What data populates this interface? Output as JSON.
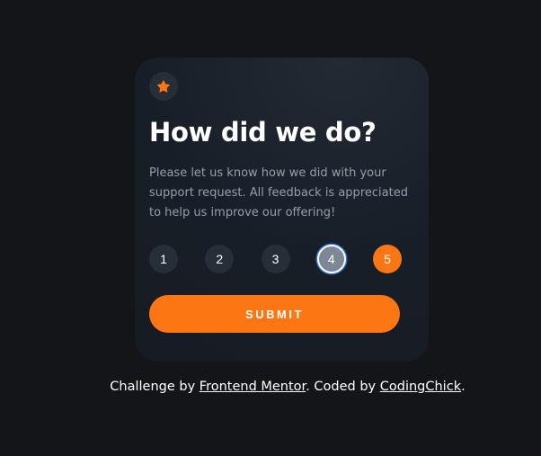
{
  "card": {
    "icon": "star-icon",
    "title": "How did we do?",
    "description": "Please let us know how we did with your support request. All feedback is appreciated to help us improve our offering!",
    "ratings": [
      "1",
      "2",
      "3",
      "4",
      "5"
    ],
    "hovered_rating": "4",
    "selected_rating": "5",
    "submit_label": "SUBMIT"
  },
  "attribution": {
    "prefix": "Challenge by",
    "link1": "Frontend Mentor",
    "middle": ". Coded by",
    "link2": "CodingChick",
    "suffix": "."
  },
  "colors": {
    "accent": "#fc7614",
    "background": "#131518",
    "card": "#1b2129",
    "muted_text": "#959eac"
  }
}
